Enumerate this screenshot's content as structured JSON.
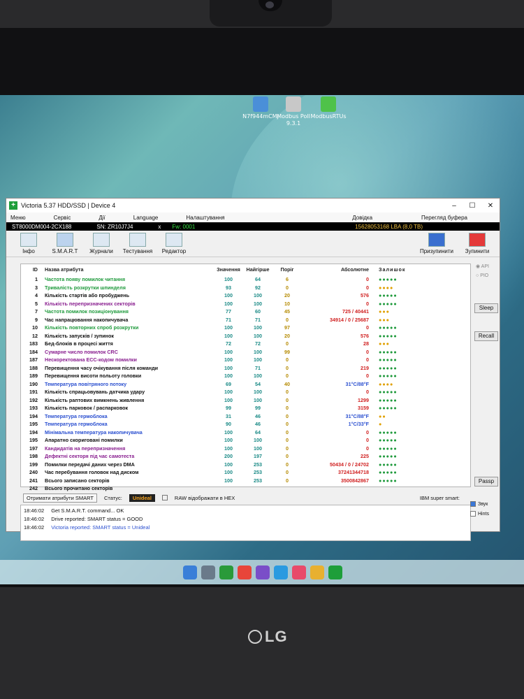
{
  "desktop": {
    "icons": [
      {
        "label": "N7f944mCMj",
        "color": "#4a8fd8"
      },
      {
        "label": "Modbus Poll 9.3.1",
        "color": "#c8c8c8"
      },
      {
        "label": "ModbusRTUs",
        "color": "#4fc24a"
      }
    ],
    "taskbar_icons": [
      "windows-icon",
      "settings-icon",
      "xbox-icon",
      "chrome-icon",
      "viber-icon",
      "telegram-icon",
      "music-icon",
      "folder-icon",
      "victoria-icon"
    ],
    "brand": "LG"
  },
  "window": {
    "title": "Victoria 5.37 HDD/SSD | Device 4",
    "menu": [
      "Меню",
      "Сервіс",
      "Дії",
      "Language",
      "Налаштування"
    ],
    "menu_right": [
      "Довідка",
      "Перегляд буфера"
    ],
    "drive": {
      "model": "ST8000DM004-2CX188",
      "serial": "SN: ZR10J7J4",
      "x": "x",
      "firmware": "Fw: 0001",
      "lba": "15628053168 LBA (8,0 TB)"
    },
    "toolbar": [
      "Інфо",
      "S.M.A.R.T",
      "Журнали",
      "Тестування",
      "Редактор"
    ],
    "toolbar_right": [
      "Призупинити",
      "Зупинити"
    ],
    "columns": [
      "ID",
      "Назва атрибута",
      "Значення",
      "Найгірше",
      "Поріг",
      "Абсолютне",
      "Залишок"
    ],
    "rows": [
      {
        "id": "1",
        "name": "Частота появу помилок читання",
        "val": "100",
        "worst": "64",
        "thr": "6",
        "abs": "0",
        "rem": "●●●●●",
        "nc": "#1f9a3c",
        "ac": "#d02020",
        "rc": "#1f9a3c"
      },
      {
        "id": "3",
        "name": "Тривалість розкрутки шпинделя",
        "val": "93",
        "worst": "92",
        "thr": "0",
        "abs": "0",
        "rem": "●●●●",
        "nc": "#1f9a3c",
        "ac": "#d02020",
        "rc": "#e0a000"
      },
      {
        "id": "4",
        "name": "Кількість стартів або пробуджень",
        "val": "100",
        "worst": "100",
        "thr": "20",
        "abs": "576",
        "rem": "●●●●●",
        "nc": "#111111",
        "ac": "#d02020",
        "rc": "#1f9a3c"
      },
      {
        "id": "5",
        "name": "Кількість перепризначених секторів",
        "val": "100",
        "worst": "100",
        "thr": "10",
        "abs": "0",
        "rem": "●●●●●",
        "nc": "#8a2090",
        "ac": "#d02020",
        "rc": "#1f9a3c"
      },
      {
        "id": "7",
        "name": "Частота помилок позиціонування",
        "val": "77",
        "worst": "60",
        "thr": "45",
        "abs": "725 / 40441",
        "rem": "●●●",
        "nc": "#1f9a3c",
        "ac": "#d02020",
        "rc": "#e0a000"
      },
      {
        "id": "9",
        "name": "Час напрацювання накопичувача",
        "val": "71",
        "worst": "71",
        "thr": "0",
        "abs": "34914 / 0 / 25687",
        "rem": "●●●",
        "nc": "#111111",
        "ac": "#d02020",
        "rc": "#e0a000"
      },
      {
        "id": "10",
        "name": "Кількість повторних спроб розкрутки",
        "val": "100",
        "worst": "100",
        "thr": "97",
        "abs": "0",
        "rem": "●●●●●",
        "nc": "#1f9a3c",
        "ac": "#d02020",
        "rc": "#1f9a3c"
      },
      {
        "id": "12",
        "name": "Кількість запусків / зупинок",
        "val": "100",
        "worst": "100",
        "thr": "20",
        "abs": "576",
        "rem": "●●●●●",
        "nc": "#111111",
        "ac": "#d02020",
        "rc": "#1f9a3c"
      },
      {
        "id": "183",
        "name": "Бед-блоків в процесі життя",
        "val": "72",
        "worst": "72",
        "thr": "0",
        "abs": "28",
        "rem": "●●●",
        "nc": "#111111",
        "ac": "#d02020",
        "rc": "#e0a000"
      },
      {
        "id": "184",
        "name": "Сумарне число помилок CRC",
        "val": "100",
        "worst": "100",
        "thr": "99",
        "abs": "0",
        "rem": "●●●●●",
        "nc": "#8a2090",
        "ac": "#d02020",
        "rc": "#1f9a3c"
      },
      {
        "id": "187",
        "name": "Нескоректована ECC-кодом помилки",
        "val": "100",
        "worst": "100",
        "thr": "0",
        "abs": "0",
        "rem": "●●●●●",
        "nc": "#8a2090",
        "ac": "#d02020",
        "rc": "#1f9a3c"
      },
      {
        "id": "188",
        "name": "Перевищення часу очікування після команди",
        "val": "100",
        "worst": "71",
        "thr": "0",
        "abs": "219",
        "rem": "●●●●●",
        "nc": "#111111",
        "ac": "#d02020",
        "rc": "#1f9a3c"
      },
      {
        "id": "189",
        "name": "Перевищення висоти польоту головки",
        "val": "100",
        "worst": "100",
        "thr": "0",
        "abs": "0",
        "rem": "●●●●●",
        "nc": "#111111",
        "ac": "#d02020",
        "rc": "#1f9a3c"
      },
      {
        "id": "190",
        "name": "Температура повітряного потоку",
        "val": "69",
        "worst": "54",
        "thr": "40",
        "abs": "31°C/88°F",
        "rem": "●●●●",
        "nc": "#2a4fd0",
        "ac": "#2a4fd0",
        "rc": "#e0a000"
      },
      {
        "id": "191",
        "name": "Кількість спрацьовувань датчика удару",
        "val": "100",
        "worst": "100",
        "thr": "0",
        "abs": "0",
        "rem": "●●●●●",
        "nc": "#111111",
        "ac": "#d02020",
        "rc": "#1f9a3c"
      },
      {
        "id": "192",
        "name": "Кількість раптових вимкнень живлення",
        "val": "100",
        "worst": "100",
        "thr": "0",
        "abs": "1299",
        "rem": "●●●●●",
        "nc": "#111111",
        "ac": "#d02020",
        "rc": "#1f9a3c"
      },
      {
        "id": "193",
        "name": "Кількість парковок / распарковок",
        "val": "99",
        "worst": "99",
        "thr": "0",
        "abs": "3159",
        "rem": "●●●●●",
        "nc": "#111111",
        "ac": "#d02020",
        "rc": "#1f9a3c"
      },
      {
        "id": "194",
        "name": "Температура гермоблока",
        "val": "31",
        "worst": "46",
        "thr": "0",
        "abs": "31°C/88°F",
        "rem": "●●",
        "nc": "#2a4fd0",
        "ac": "#2a4fd0",
        "rc": "#e0a000"
      },
      {
        "id": "195",
        "name": "Температура гермоблока",
        "val": "90",
        "worst": "46",
        "thr": "0",
        "abs": "1°C/33°F",
        "rem": "●",
        "nc": "#2a4fd0",
        "ac": "#2a4fd0",
        "rc": "#e0a000"
      },
      {
        "id": "194",
        "name": "Мінімальна температура накопичувача",
        "val": "100",
        "worst": "64",
        "thr": "0",
        "abs": "0",
        "rem": "●●●●●",
        "nc": "#2a4fd0",
        "ac": "#d02020",
        "rc": "#1f9a3c"
      },
      {
        "id": "195",
        "name": "Апаратно скориговані помилки",
        "val": "100",
        "worst": "100",
        "thr": "0",
        "abs": "0",
        "rem": "●●●●●",
        "nc": "#111111",
        "ac": "#d02020",
        "rc": "#1f9a3c"
      },
      {
        "id": "197",
        "name": "Кандидатів на перепризначення",
        "val": "100",
        "worst": "100",
        "thr": "0",
        "abs": "0",
        "rem": "●●●●●",
        "nc": "#8a2090",
        "ac": "#d02020",
        "rc": "#1f9a3c"
      },
      {
        "id": "198",
        "name": "Дефектні секторя під час самотеста",
        "val": "200",
        "worst": "197",
        "thr": "0",
        "abs": "225",
        "rem": "●●●●●",
        "nc": "#8a2090",
        "ac": "#d02020",
        "rc": "#1f9a3c"
      },
      {
        "id": "199",
        "name": "Помилки передачі даних через DMA",
        "val": "100",
        "worst": "253",
        "thr": "0",
        "abs": "50434 / 0 / 24702",
        "rem": "●●●●●",
        "nc": "#111111",
        "ac": "#d02020",
        "rc": "#1f9a3c"
      },
      {
        "id": "240",
        "name": "Час перебування головок над диском",
        "val": "100",
        "worst": "253",
        "thr": "0",
        "abs": "37241344718",
        "rem": "●●●●●",
        "nc": "#111111",
        "ac": "#d02020",
        "rc": "#1f9a3c"
      },
      {
        "id": "241",
        "name": "Всього записано секторів",
        "val": "100",
        "worst": "253",
        "thr": "0",
        "abs": "3500842867",
        "rem": "●●●●●",
        "nc": "#111111",
        "ac": "#d02020",
        "rc": "#1f9a3c"
      },
      {
        "id": "242",
        "name": "Всього прочитано секторів",
        "val": "",
        "worst": "",
        "thr": "",
        "abs": "",
        "rem": "",
        "nc": "#111111",
        "ac": "#d02020",
        "rc": "#1f9a3c"
      }
    ],
    "side": {
      "api": "API",
      "pio": "PIO",
      "sleep": "Sleep",
      "recall": "Recall",
      "passp": "Passp"
    },
    "status": {
      "get_btn": "Отримати атрибути SMART",
      "status_label": "Статус:",
      "status_value": "Unideal",
      "raw_hex": "RAW відображати в HEX",
      "ibm": "IBM super smart:"
    },
    "log": [
      {
        "time": "18:46:02",
        "msg": "Get S.M.A.R.T. command... OK"
      },
      {
        "time": "18:46:02",
        "msg": "Drive reported: SMART status = GOOD"
      },
      {
        "time": "18:46:02",
        "msg": "Victoria reported: SMART status = Unideal"
      }
    ],
    "options": {
      "sound": "Звук",
      "hints": "Hints"
    }
  }
}
